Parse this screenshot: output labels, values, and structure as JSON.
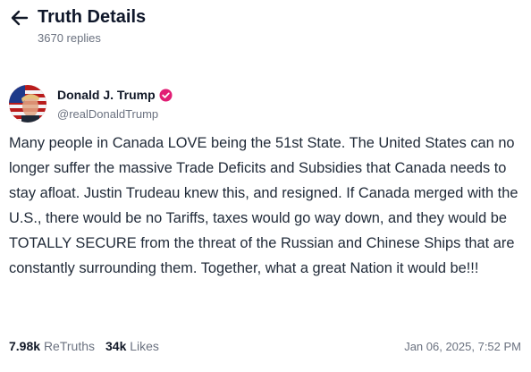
{
  "colors": {
    "verified_badge": "#e11d74",
    "text_primary": "#1f2937",
    "text_muted": "#6b7280",
    "background": "#ffffff"
  },
  "header": {
    "back_icon": "arrow-left-icon",
    "title": "Truth Details",
    "replies": "3670 replies"
  },
  "author": {
    "name": "Donald J. Trump",
    "handle": "@realDonaldTrump",
    "verified_icon": "verified-badge-icon"
  },
  "post": {
    "body": "Many people in Canada LOVE being the 51st State. The United States can no longer suffer the massive Trade Deficits and Subsidies that Canada needs to stay afloat. Justin Trudeau knew this, and resigned. If Canada merged with the U.S., there would be no Tariffs, taxes would go way down, and they would be TOTALLY SECURE from the threat of the Russian and Chinese Ships that are constantly surrounding them. Together, what a great Nation it would be!!!",
    "retruths_count": "7.98k",
    "retruths_label": "ReTruths",
    "likes_count": "34k",
    "likes_label": "Likes",
    "timestamp": "Jan 06, 2025, 7:52 PM"
  }
}
